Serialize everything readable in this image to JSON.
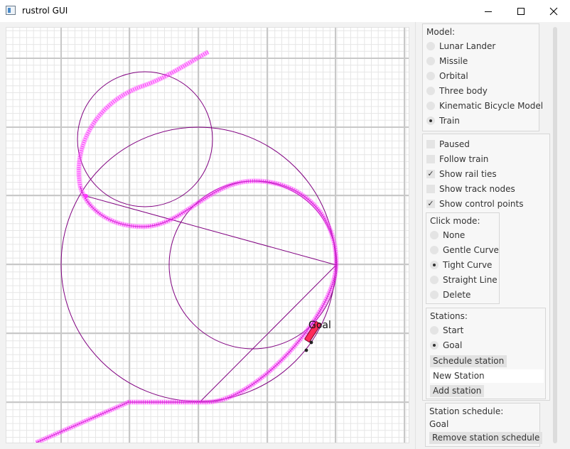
{
  "window": {
    "title": "rustrol GUI",
    "controls": {
      "minimize_icon": "minimize-icon",
      "maximize_icon": "maximize-icon",
      "close_icon": "close-icon"
    }
  },
  "canvas": {
    "goal_label": "Goal",
    "colors": {
      "track": "#ff33ff",
      "construction": "#800080",
      "grid_major": "#c8c8c8",
      "grid_minor": "#e6e6e6"
    }
  },
  "model": {
    "title": "Model:",
    "options": [
      {
        "label": "Lunar Lander",
        "selected": false
      },
      {
        "label": "Missile",
        "selected": false
      },
      {
        "label": "Orbital",
        "selected": false
      },
      {
        "label": "Three body",
        "selected": false
      },
      {
        "label": "Kinematic Bicycle Model",
        "selected": false
      },
      {
        "label": "Train",
        "selected": true
      }
    ]
  },
  "options": {
    "checkboxes": [
      {
        "label": "Paused",
        "checked": false
      },
      {
        "label": "Follow train",
        "checked": false
      },
      {
        "label": "Show rail ties",
        "checked": true
      },
      {
        "label": "Show track nodes",
        "checked": false
      },
      {
        "label": "Show control points",
        "checked": true
      }
    ]
  },
  "click_mode": {
    "title": "Click mode:",
    "options": [
      {
        "label": "None",
        "selected": false
      },
      {
        "label": "Gentle Curve",
        "selected": false
      },
      {
        "label": "Tight Curve",
        "selected": true
      },
      {
        "label": "Straight Line",
        "selected": false
      },
      {
        "label": "Delete",
        "selected": false
      }
    ]
  },
  "stations": {
    "title": "Stations:",
    "options": [
      {
        "label": "Start",
        "selected": false
      },
      {
        "label": "Goal",
        "selected": true
      }
    ],
    "schedule_button": "Schedule station",
    "new_station_value": "New Station",
    "add_button": "Add station"
  },
  "station_schedule": {
    "title": "Station schedule:",
    "entries": [
      "Goal"
    ],
    "remove_button": "Remove station schedule"
  }
}
